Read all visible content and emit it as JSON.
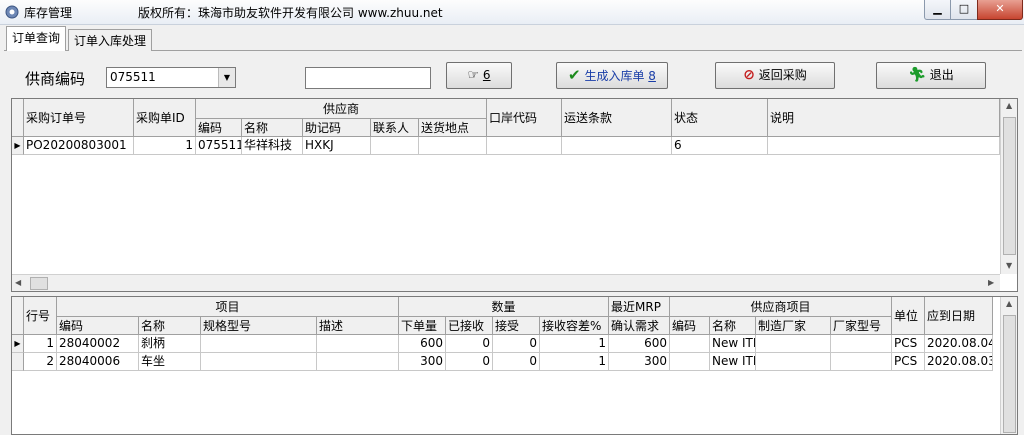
{
  "window": {
    "title": "库存管理",
    "copyright": "版权所有：珠海市助友软件开发有限公司 www.zhuu.net",
    "min_label": "▁",
    "max_label": "□",
    "close_label": "✕"
  },
  "tabs": [
    {
      "label": "订单查询",
      "active": true
    },
    {
      "label": "订单入库处理",
      "active": false
    }
  ],
  "controls": {
    "supplier_label": "供商编码",
    "supplier_value": "075511",
    "search_value": "",
    "search_btn": "6",
    "generate_btn": "生成入库单",
    "generate_key": "8",
    "return_btn": "返回采购",
    "exit_btn": "退出",
    "accent": "#1a3ea8"
  },
  "order_grid": {
    "headers": {
      "po_no": "采购订单号",
      "po_id": "采购单ID",
      "supplier_group": "供应商",
      "code": "编码",
      "name": "名称",
      "mnemonic": "助记码",
      "contact": "联系人",
      "ship_to": "送货地点",
      "port_code": "口岸代码",
      "shipping_terms": "运送条款",
      "status": "状态",
      "remark": "说明"
    },
    "rows": [
      {
        "po_no": "PO20200803001",
        "po_id": "1",
        "code": "075511",
        "name": "华祥科技",
        "mnemonic": "HXKJ",
        "contact": "",
        "ship_to": "",
        "port_code": "",
        "shipping_terms": "",
        "status": "6",
        "remark": ""
      }
    ]
  },
  "item_grid": {
    "headers": {
      "line_no": "行号",
      "item_group": "项目",
      "code": "编码",
      "name": "名称",
      "spec": "规格型号",
      "desc": "描述",
      "qty_group": "数量",
      "order_qty": "下单量",
      "received": "已接收",
      "accept": "接受",
      "tolerance": "接收容差%",
      "mrp_group": "最近MRP",
      "confirm_demand": "确认需求",
      "vendor_group": "供应商项目",
      "v_code": "编码",
      "v_name": "名称",
      "maker": "制造厂家",
      "maker_model": "厂家型号",
      "unit": "单位",
      "due_date": "应到日期"
    },
    "rows": [
      {
        "line_no": "1",
        "code": "28040002",
        "name": "刹柄",
        "spec": "",
        "desc": "",
        "order_qty": "600",
        "received": "0",
        "accept": "0",
        "tolerance": "1",
        "confirm_demand": "600",
        "v_code": "",
        "v_name": "New ITI",
        "maker": "",
        "maker_model": "",
        "unit": "PCS",
        "due_date": "2020.08.04"
      },
      {
        "line_no": "2",
        "code": "28040006",
        "name": "车坐",
        "spec": "",
        "desc": "",
        "order_qty": "300",
        "received": "0",
        "accept": "0",
        "tolerance": "1",
        "confirm_demand": "300",
        "v_code": "",
        "v_name": "New ITI",
        "maker": "",
        "maker_model": "",
        "unit": "PCS",
        "due_date": "2020.08.03"
      }
    ]
  }
}
